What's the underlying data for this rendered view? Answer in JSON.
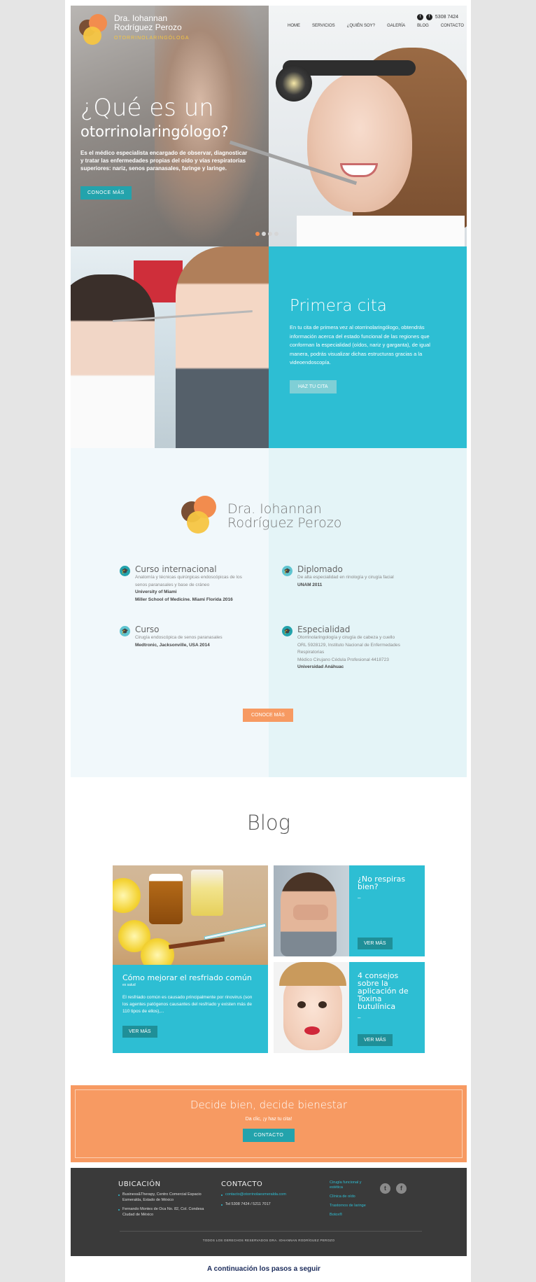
{
  "header": {
    "logo_line1": "Dra. Iohannan",
    "logo_line2": "Rodríguez Perozo",
    "logo_sub": "OTORRINOLARINGÓLOGA",
    "phone": "5308 7424",
    "nav": [
      "HOME",
      "SERVICIOS",
      "¿QUIÉN SOY?",
      "GALERÍA",
      "BLOG",
      "CONTACTO"
    ]
  },
  "hero": {
    "title_line1": "¿Qué es un",
    "title_line2": "otorrinolaringólogo?",
    "description": "Es el médico especialista encargado de observar, diagnosticar y tratar las enfermedades propias del oído y vías respiratorias superiores: nariz, senos paranasales, faringe y laringe.",
    "button": "CONOCE MÁS"
  },
  "cita": {
    "title": "Primera cita",
    "description": "En tu cita de primera vez al otorrinolaringólogo, obtendrás información acerca del estado funcional de las regiones que conforman la especialidad (oídos, nariz y garganta), de igual manera, podrás visualizar dichas estructuras gracias a la videoendoscopía.",
    "button": "HAZ TU CITA"
  },
  "doctor": {
    "name_line1": "Dra.  Iohannan",
    "name_line2": "Rodríguez  Perozo",
    "credentials": [
      {
        "title": "Curso internacional",
        "lines": [
          "Anatomía y técnicas quirúrgicas endoscópicas de los",
          "senos paranasales y base de cráneo"
        ],
        "bold": [
          "University of Miami",
          "Miller School of Medicine. Miami Florida 2016"
        ]
      },
      {
        "title": "Diplomado",
        "lines": [
          "De alta especialidad en rinología y cirugía facial"
        ],
        "bold": [
          "UNAM 2011"
        ]
      },
      {
        "title": "Curso",
        "lines": [
          "Cirugía endoscópica de senos paranasales"
        ],
        "bold": [
          "Medtronic, Jacksonville, USA 2014"
        ]
      },
      {
        "title": "Especialidad",
        "lines": [
          "Otorrinolaringología y cirugía de cabeza y cuello",
          "ORL 5928129, Instituto Nacional de Enfermedades",
          "Respiratorias",
          "Médico Cirujano Cédula Profesional 4418723"
        ],
        "bold": [
          "Universidad Anáhuac"
        ]
      }
    ],
    "button": "CONOCE MÁS"
  },
  "blog": {
    "title": "Blog",
    "posts": [
      {
        "title": "Cómo mejorar el resfriado común",
        "sub": "ex salud",
        "excerpt": "El resfriado común es causado principalmente por rinovirus (son los agentes patógenos causantes del resfriado y existen más de 110 tipos de ellos),...",
        "button": "VER MÁS"
      },
      {
        "title_line1": "¿No respiras",
        "title_line2": "bien?",
        "dash": "–",
        "button": "VER MÁS"
      },
      {
        "title_line1": "4 consejos",
        "title_line2": "sobre la",
        "title_line3": "aplicación de",
        "title_line4": "Toxina",
        "title_line5": "butulínica",
        "dash": "–",
        "button": "VER MÁS"
      }
    ]
  },
  "cta": {
    "title": "Decide bien, decide bienestar",
    "subtitle": "Da clic, ¡y haz tu cita!",
    "button": "CONTACTO"
  },
  "footer": {
    "ubicacion_title": "UBICACIÓN",
    "ubicacion": [
      "Business&Therapy, Centro Comercial Espacio Esmeralda, Estado de México",
      "Fernando Montes de Oca No. 82, Col. Condesa Ciudad de México"
    ],
    "contacto_title": "CONTACTO",
    "contacto": [
      "contacto@otorrinolaesmeralda.com",
      "Tel 5308 7424 / 5211 7017"
    ],
    "links": [
      "Cirugía funcional y estética",
      "Clínica de oído",
      "Trastornos de laringe",
      "Botox®"
    ],
    "copyright": "TODOS LOS DERECHOS RESERVADOS DRA. IOHANNAN RODRÍGUEZ PEROZO"
  },
  "below_text": "A continuación los pasos a seguir",
  "colors": {
    "teal": "#2dbed3",
    "dark_teal": "#23a3ac",
    "orange": "#f79a62",
    "footer": "#3a3a3a"
  }
}
